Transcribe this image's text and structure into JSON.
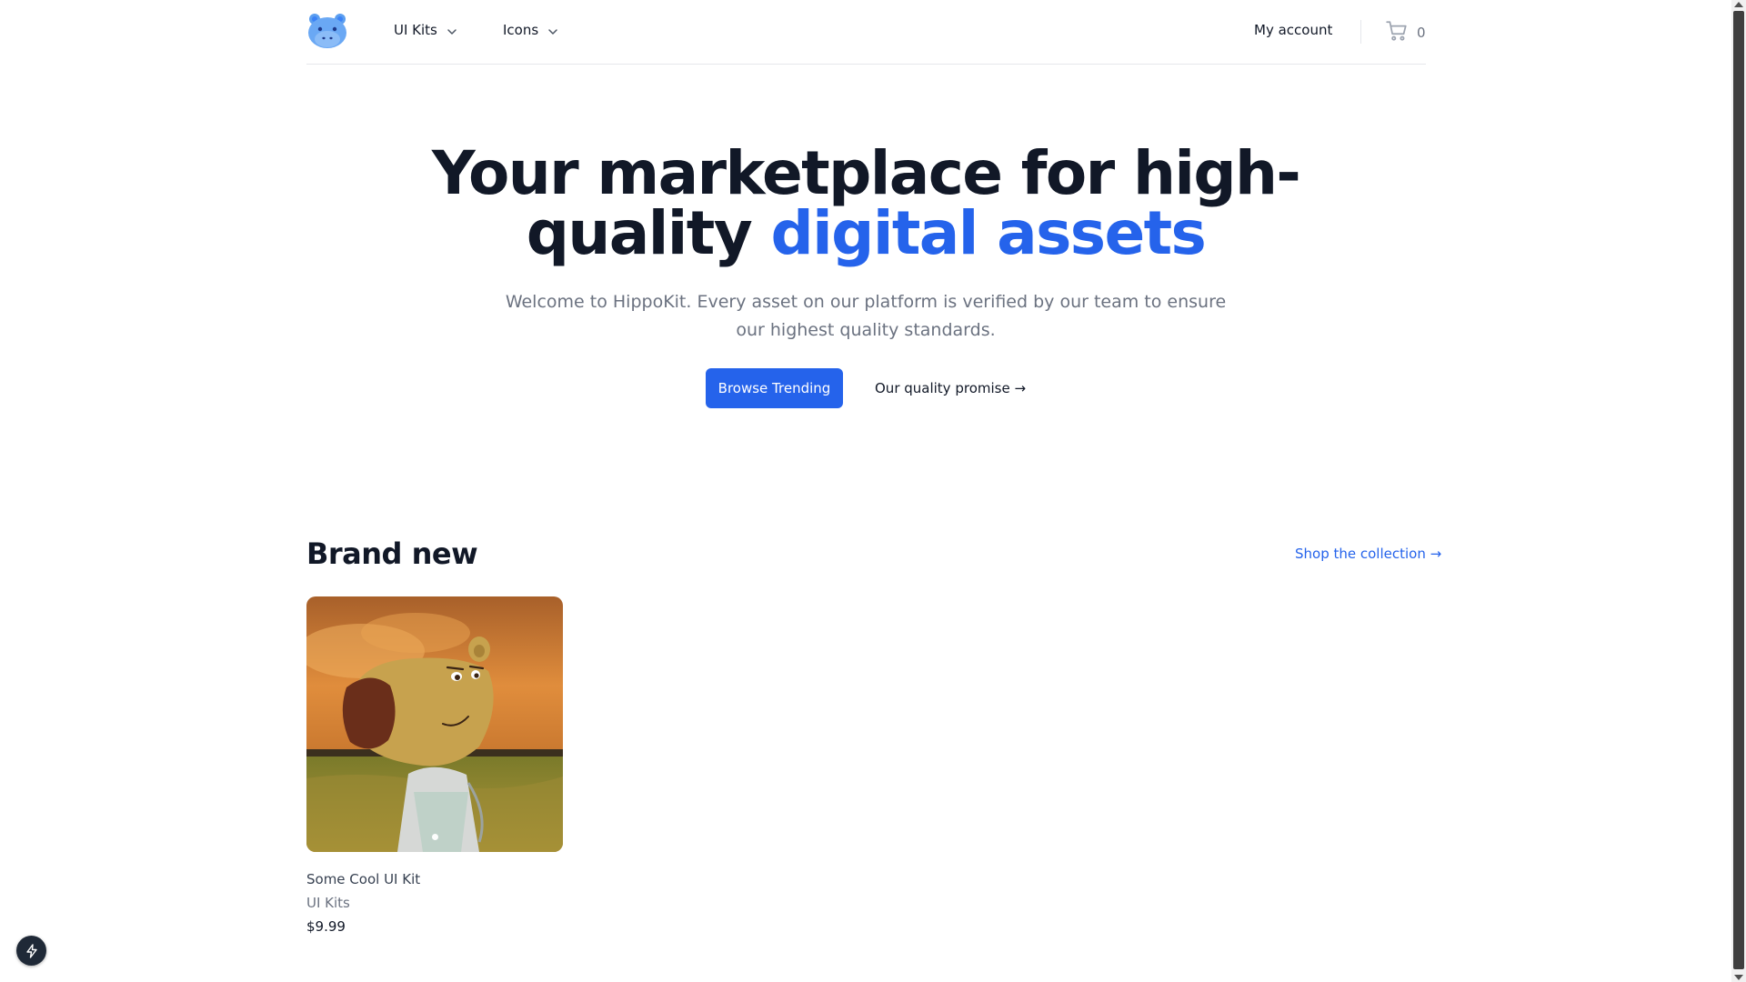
{
  "header": {
    "logo_icon": "hippo-logo-icon",
    "nav": [
      {
        "label": "UI Kits",
        "icon": "chevron-down-icon"
      },
      {
        "label": "Icons",
        "icon": "chevron-down-icon"
      }
    ],
    "account_label": "My account",
    "cart": {
      "icon": "cart-icon",
      "count": "0"
    }
  },
  "hero": {
    "title_part1": "Your marketplace for high-quality",
    "title_accent": "digital assets",
    "subtitle": "Welcome to HippoKit. Every asset on our platform is verified by our team to ensure our highest quality standards.",
    "primary_button": "Browse Trending",
    "secondary_link": "Our quality promise →"
  },
  "brand_new": {
    "title": "Brand new",
    "shop_link": "Shop the collection →",
    "products": [
      {
        "name": "Some Cool UI Kit",
        "category": "UI Kits",
        "price": "$9.99",
        "image_count": 1
      }
    ]
  },
  "floating_button": {
    "icon": "lightning-icon"
  },
  "colors": {
    "accent": "#2563eb",
    "text": "#111827",
    "muted": "#6b7280",
    "border": "#e5e7eb"
  }
}
